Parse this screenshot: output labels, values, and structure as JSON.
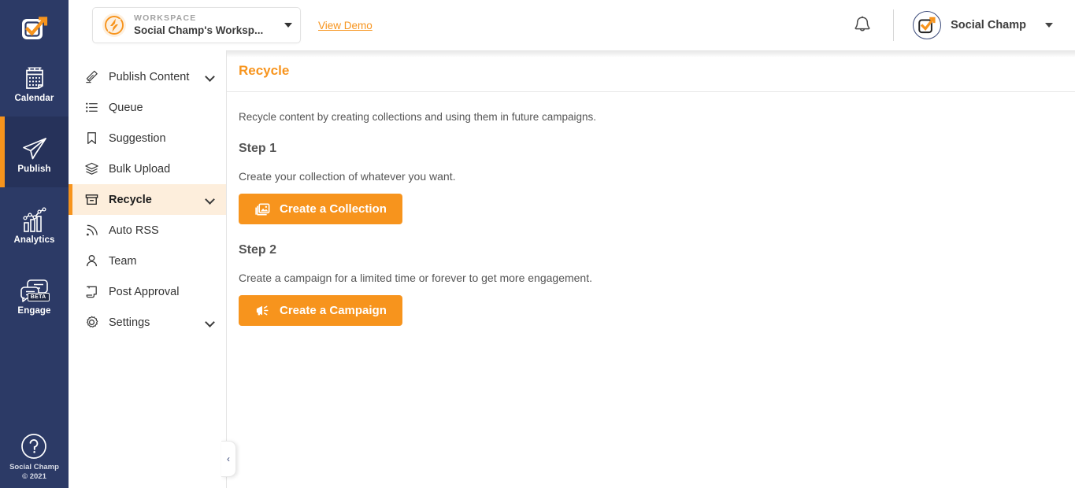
{
  "brand": {
    "accent_orange": "#f7941d",
    "rail_navy": "#2c3a66",
    "rail_navy_active": "#26325a",
    "active_nav_bg": "#fdeedc",
    "logo_icon": "checkbox-arrow-logo-icon"
  },
  "rail": {
    "items": [
      {
        "label": "Calendar",
        "icon": "calendar-icon",
        "active": false,
        "badge": ""
      },
      {
        "label": "Publish",
        "icon": "paper-plane-icon",
        "active": true,
        "badge": ""
      },
      {
        "label": "Analytics",
        "icon": "bar-chart-line-icon",
        "active": false,
        "badge": ""
      },
      {
        "label": "Engage",
        "icon": "chat-bubbles-icon",
        "active": false,
        "badge": "BETA"
      }
    ],
    "help": {
      "icon": "question-circle-icon",
      "line1": "Social Champ",
      "line2": "© 2021"
    }
  },
  "topbar": {
    "workspace": {
      "kicker": "WORKSPACE",
      "name": "Social Champ's Worksp...",
      "avatar_icon": "lightning-bolt-icon",
      "caret_icon": "chevron-down-icon"
    },
    "view_demo": "View Demo",
    "bell_icon": "bell-icon",
    "user": {
      "name": "Social Champ",
      "avatar_icon": "checkbox-arrow-logo-icon",
      "caret_icon": "chevron-down-icon"
    }
  },
  "subnav": {
    "items": [
      {
        "label": "Publish Content",
        "icon": "pencil-icon",
        "active": false,
        "expandable": true
      },
      {
        "label": "Queue",
        "icon": "list-icon",
        "active": false,
        "expandable": false
      },
      {
        "label": "Suggestion",
        "icon": "bookmark-icon",
        "active": false,
        "expandable": false
      },
      {
        "label": "Bulk Upload",
        "icon": "layers-icon",
        "active": false,
        "expandable": false
      },
      {
        "label": "Recycle",
        "icon": "archive-box-icon",
        "active": true,
        "expandable": true
      },
      {
        "label": "Auto RSS",
        "icon": "rss-icon",
        "active": false,
        "expandable": false
      },
      {
        "label": "Team",
        "icon": "person-icon",
        "active": false,
        "expandable": false
      },
      {
        "label": "Post Approval",
        "icon": "scroll-icon",
        "active": false,
        "expandable": false
      },
      {
        "label": "Settings",
        "icon": "gear-icon",
        "active": false,
        "expandable": true
      }
    ],
    "collapse_handle_icon": "chevron-left-icon",
    "collapse_handle_glyph": "‹"
  },
  "page": {
    "title": "Recycle",
    "intro": "Recycle content by creating collections and using them in future campaigns.",
    "step1": {
      "title": "Step 1",
      "description": "Create your collection of whatever you want.",
      "button_label": "Create a Collection",
      "button_icon": "images-stack-icon"
    },
    "step2": {
      "title": "Step 2",
      "description": "Create a campaign for a limited time or forever to get more engagement.",
      "button_label": "Create a Campaign",
      "button_icon": "megaphone-icon"
    }
  }
}
